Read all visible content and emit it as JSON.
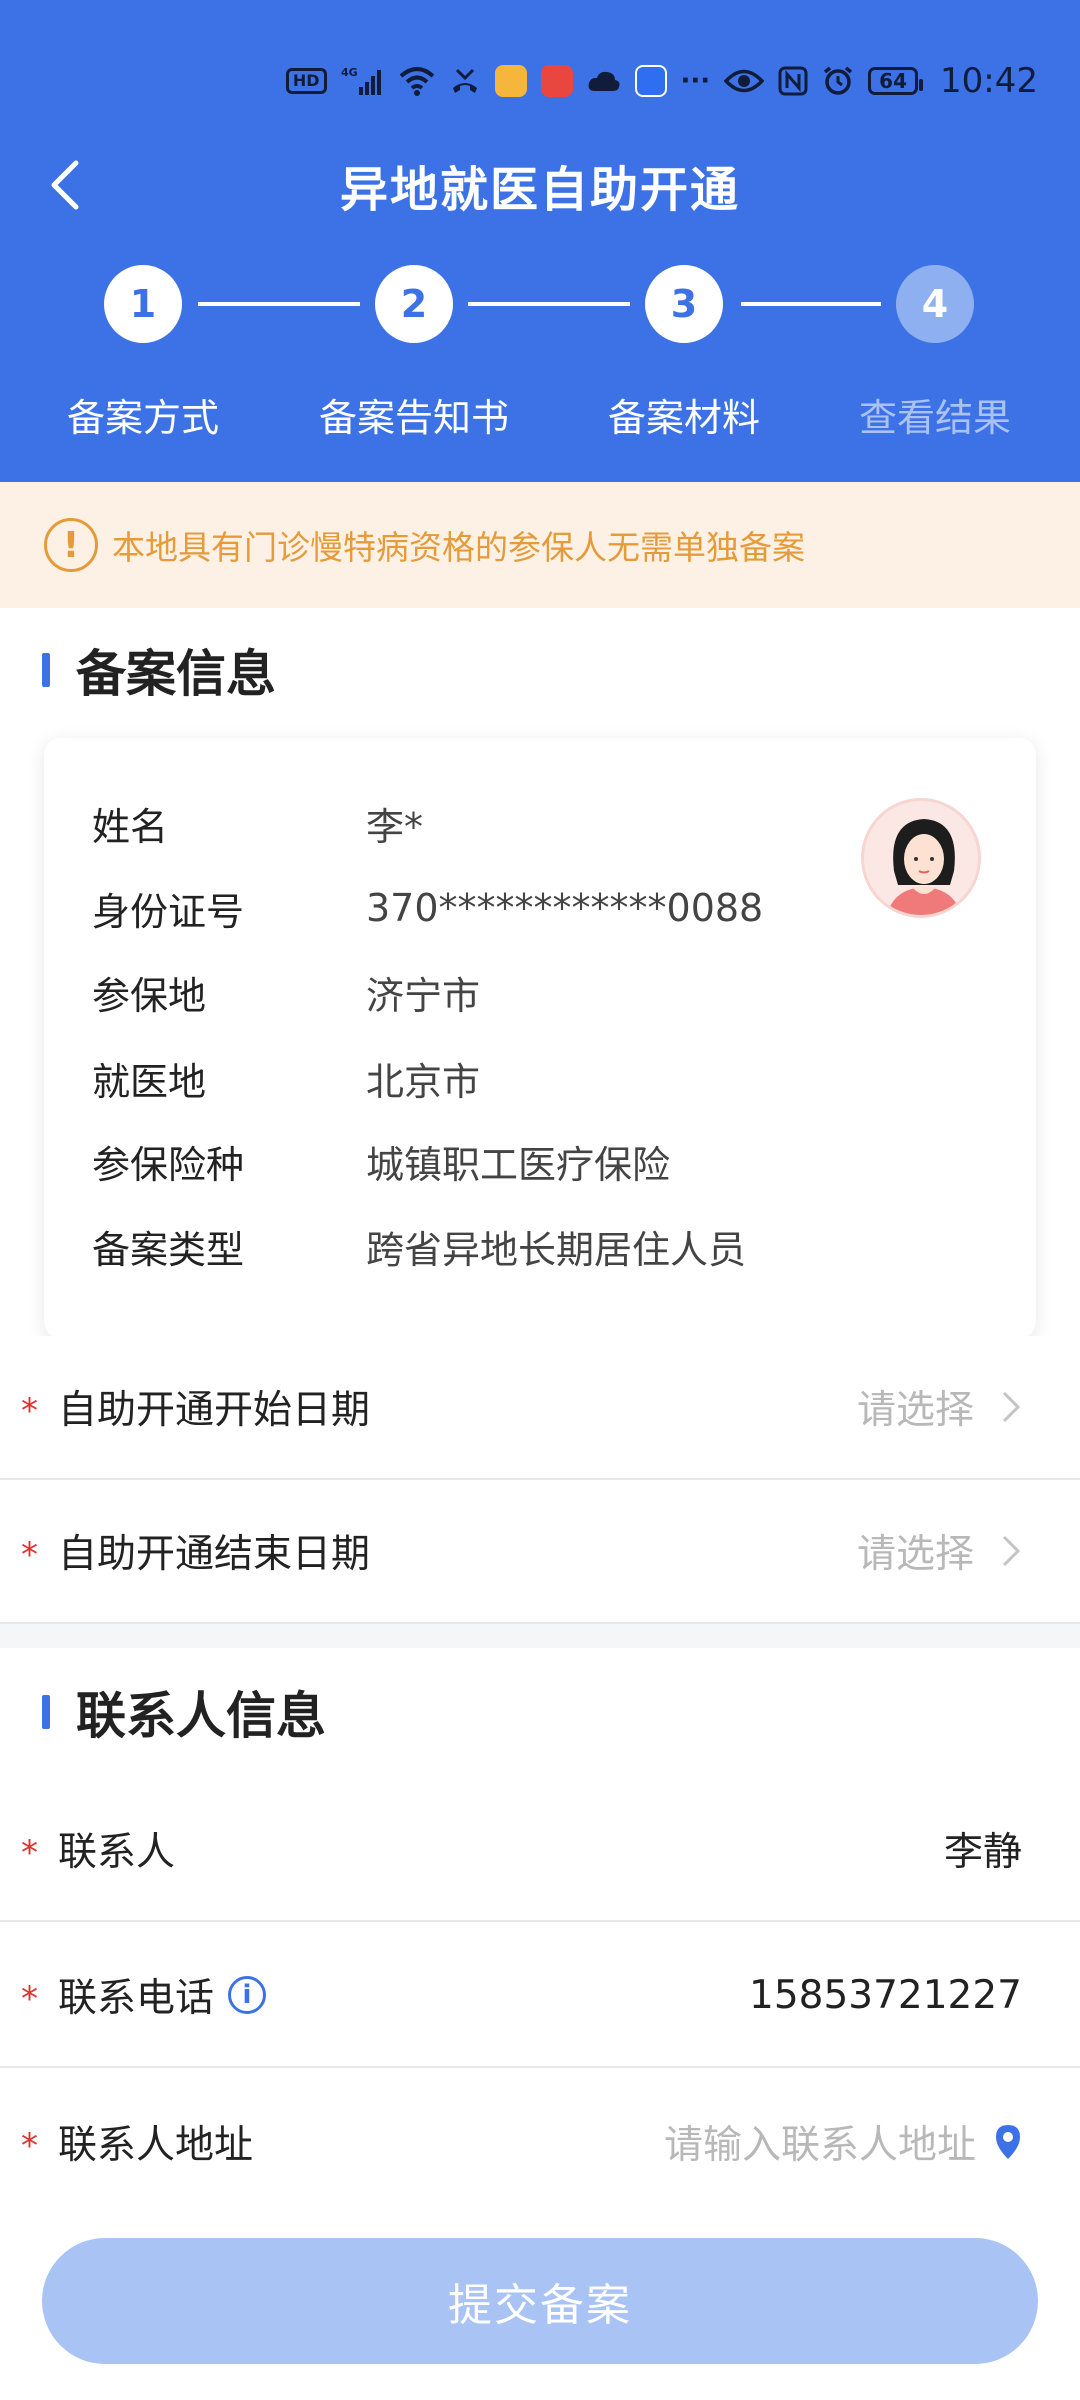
{
  "status_bar": {
    "hd": "HD",
    "network": "4G",
    "battery": "64",
    "time": "10:42",
    "icons": [
      "hd-icon",
      "signal-icon",
      "wifi-icon",
      "missed-call-icon",
      "app-icon",
      "book-app-icon",
      "cloud-icon",
      "bulb-app-icon",
      "more-icon",
      "eye-icon",
      "nfc-icon",
      "alarm-icon",
      "battery-icon"
    ]
  },
  "header": {
    "title": "异地就医自助开通",
    "back_icon": "chevron-left-icon"
  },
  "steps": [
    {
      "number": "1",
      "label": "备案方式",
      "state": "done"
    },
    {
      "number": "2",
      "label": "备案告知书",
      "state": "done"
    },
    {
      "number": "3",
      "label": "备案材料",
      "state": "current"
    },
    {
      "number": "4",
      "label": "查看结果",
      "state": "inactive"
    }
  ],
  "notice": {
    "icon": "alert-circle-icon",
    "text": "本地具有门诊慢特病资格的参保人无需单独备案"
  },
  "filing_info": {
    "section_title": "备案信息",
    "rows": [
      {
        "label": "姓名",
        "value": "李*"
      },
      {
        "label": "身份证号",
        "value": "370************0088"
      },
      {
        "label": "参保地",
        "value": "济宁市"
      },
      {
        "label": "就医地",
        "value": "北京市"
      },
      {
        "label": "参保险种",
        "value": "城镇职工医疗保险"
      },
      {
        "label": "备案类型",
        "value": "跨省异地长期居住人员"
      }
    ],
    "avatar": "female-avatar-icon"
  },
  "dates": {
    "start_label": "自助开通开始日期",
    "start_placeholder": "请选择",
    "end_label": "自助开通结束日期",
    "end_placeholder": "请选择",
    "required_mark": "*"
  },
  "contact": {
    "section_title": "联系人信息",
    "name_label": "联系人",
    "name_value": "李静",
    "phone_label": "联系电话",
    "phone_value": "15853721227",
    "address_label": "联系人地址",
    "address_placeholder": "请输入联系人地址"
  },
  "submit_label": "提交备案",
  "colors": {
    "primary": "#3d72e6",
    "notice": "#e59b3a",
    "required": "#e3302f",
    "submit_disabled": "#a9c3f5"
  }
}
